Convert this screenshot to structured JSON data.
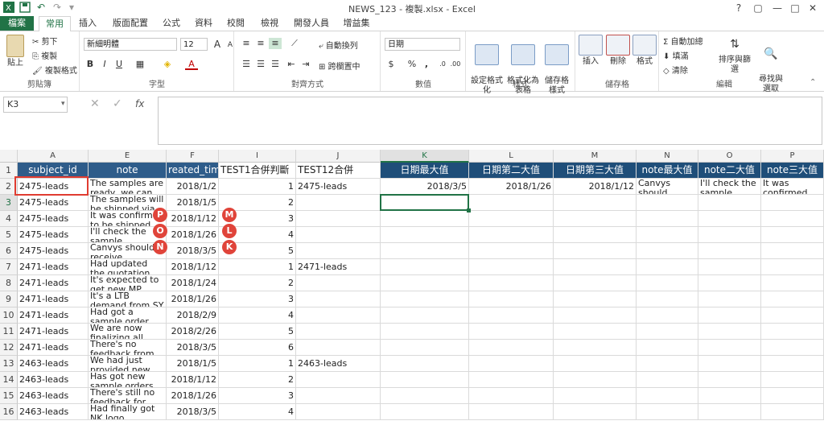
{
  "window": {
    "title": "NEWS_123 - 複製.xlsx - Excel",
    "help": "?",
    "restore": "▢",
    "minimize": "—",
    "maximize": "□",
    "close": "✕"
  },
  "tabs": [
    "檔案",
    "常用",
    "插入",
    "版面配置",
    "公式",
    "資料",
    "校閱",
    "檢視",
    "開發人員",
    "增益集"
  ],
  "ribbon": {
    "clipboard": {
      "label": "剪貼簿",
      "paste": "貼上",
      "cut": "剪下",
      "copy": "複製",
      "format_painter": "複製格式"
    },
    "font": {
      "label": "字型",
      "name": "新細明體",
      "size": "12",
      "bold": "B",
      "italic": "I",
      "underline": "U"
    },
    "alignment": {
      "label": "對齊方式",
      "wrap": "自動換列",
      "merge": "跨欄置中"
    },
    "number": {
      "label": "數值",
      "format": "日期",
      "currency": "$",
      "percent": "%",
      "comma": ","
    },
    "styles": {
      "label": "樣式",
      "conditional": "設定格式化\n的條件",
      "table": "格式化為\n表格",
      "cell": "儲存格\n樣式"
    },
    "cells": {
      "label": "儲存格",
      "insert": "插入",
      "delete": "刪除",
      "format": "格式"
    },
    "editing": {
      "label": "編輯",
      "autosum": "自動加總",
      "fill": "填滿",
      "clear": "清除",
      "sort": "排序與篩選",
      "find": "尋找與\n選取"
    }
  },
  "formula_bar": {
    "name_box": "K3",
    "fx": "fx",
    "value": ""
  },
  "columns": [
    {
      "letter": "A",
      "header": "subject_id"
    },
    {
      "letter": "E",
      "header": "note"
    },
    {
      "letter": "F",
      "header": "reated_tim"
    },
    {
      "letter": "I",
      "header": "TEST1合併判斷"
    },
    {
      "letter": "J",
      "header": "TEST12合併"
    },
    {
      "letter": "K",
      "header": "日期最大值"
    },
    {
      "letter": "L",
      "header": "日期第二大值"
    },
    {
      "letter": "M",
      "header": "日期第三大值"
    },
    {
      "letter": "N",
      "header": "note最大值"
    },
    {
      "letter": "O",
      "header": "note二大值"
    },
    {
      "letter": "P",
      "header": "note三大值"
    }
  ],
  "rows": [
    {
      "num": "2",
      "cells": [
        "2475-leads",
        "The samples are ready, we can...",
        "2018/1/2",
        "1",
        "2475-leads",
        "2018/3/5",
        "2018/1/26",
        "2018/1/12",
        "Canvys should receive...",
        "I'll check the sample...",
        "It was confirmed to..."
      ]
    },
    {
      "num": "3",
      "cells": [
        "2475-leads",
        "The samples will be shipped via...",
        "2018/1/5",
        "2",
        "",
        "",
        "",
        "",
        "",
        "",
        ""
      ]
    },
    {
      "num": "4",
      "cells": [
        "2475-leads",
        "It was confirmed to be shipped...",
        "2018/1/12",
        "3",
        "",
        "",
        "",
        "",
        "",
        "",
        ""
      ]
    },
    {
      "num": "5",
      "cells": [
        "2475-leads",
        "I'll check the sample validation...",
        "2018/1/26",
        "4",
        "",
        "",
        "",
        "",
        "",
        "",
        ""
      ]
    },
    {
      "num": "6",
      "cells": [
        "2475-leads",
        "Canvys should receive...",
        "2018/3/5",
        "5",
        "",
        "",
        "",
        "",
        "",
        "",
        ""
      ]
    },
    {
      "num": "7",
      "cells": [
        "2471-leads",
        "Had updated the quotation to...",
        "2018/1/12",
        "1",
        "2471-leads",
        "",
        "",
        "",
        "",
        "",
        ""
      ]
    },
    {
      "num": "8",
      "cells": [
        "2471-leads",
        "It's expected to get new MP blanket...",
        "2018/1/24",
        "2",
        "",
        "",
        "",
        "",
        "",
        "",
        ""
      ]
    },
    {
      "num": "9",
      "cells": [
        "2471-leads",
        "It's a LTB demand from SY for...",
        "2018/1/26",
        "3",
        "",
        "",
        "",
        "",
        "",
        "",
        ""
      ]
    },
    {
      "num": "10",
      "cells": [
        "2471-leads",
        "Had got a sample order and kicked...",
        "2018/2/9",
        "4",
        "",
        "",
        "",
        "",
        "",
        "",
        ""
      ]
    },
    {
      "num": "11",
      "cells": [
        "2471-leads",
        "We are now finalizing all...",
        "2018/2/26",
        "5",
        "",
        "",
        "",
        "",
        "",
        "",
        ""
      ]
    },
    {
      "num": "12",
      "cells": [
        "2471-leads",
        "There's no feedback from...",
        "2018/3/5",
        "6",
        "",
        "",
        "",
        "",
        "",
        "",
        ""
      ]
    },
    {
      "num": "13",
      "cells": [
        "2463-leads",
        "We had just provided new logo...",
        "2018/1/5",
        "1",
        "2463-leads",
        "",
        "",
        "",
        "",
        "",
        ""
      ]
    },
    {
      "num": "14",
      "cells": [
        "2463-leads",
        "Has got new sample orders...",
        "2018/1/12",
        "2",
        "",
        "",
        "",
        "",
        "",
        "",
        ""
      ]
    },
    {
      "num": "15",
      "cells": [
        "2463-leads",
        "There's still no feedback for NK...",
        "2018/1/26",
        "3",
        "",
        "",
        "",
        "",
        "",
        "",
        ""
      ]
    },
    {
      "num": "16",
      "cells": [
        "2463-leads",
        "Had finally got NK logo drawing...",
        "2018/3/5",
        "4",
        "",
        "",
        "",
        "",
        "",
        "",
        ""
      ]
    }
  ],
  "header_row_num": "1",
  "badges": [
    "P",
    "M",
    "O",
    "L",
    "N",
    "K"
  ],
  "colors": {
    "excel_green": "#217346",
    "header_blue": "#2e5c8a",
    "badge_red": "#e0443a",
    "selection_red": "#e03c31"
  }
}
